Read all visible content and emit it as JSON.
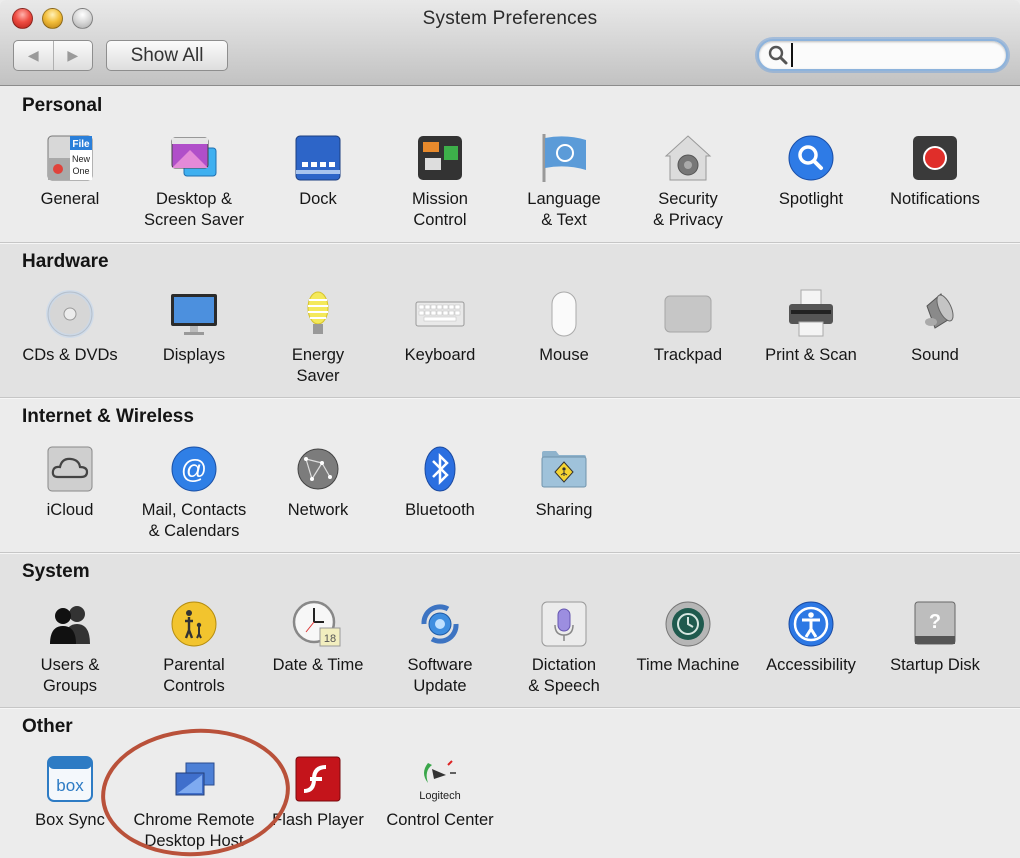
{
  "window": {
    "title": "System Preferences",
    "traffic_lights": [
      "close",
      "minimize",
      "zoom"
    ]
  },
  "toolbar": {
    "back_icon": "back-arrow-icon",
    "forward_icon": "forward-arrow-icon",
    "back_glyph": "◀",
    "forward_glyph": "▶",
    "show_all_label": "Show All",
    "search": {
      "value": "",
      "placeholder": "",
      "icon": "magnifier-icon"
    }
  },
  "sections": [
    {
      "title": "Personal",
      "items": [
        {
          "label": [
            "General"
          ],
          "icon": "general-icon"
        },
        {
          "label": [
            "Desktop &",
            "Screen Saver"
          ],
          "icon": "desktop-screensaver-icon"
        },
        {
          "label": [
            "Dock"
          ],
          "icon": "dock-icon"
        },
        {
          "label": [
            "Mission",
            "Control"
          ],
          "icon": "mission-control-icon"
        },
        {
          "label": [
            "Language",
            "& Text"
          ],
          "icon": "language-flag-icon"
        },
        {
          "label": [
            "Security",
            "& Privacy"
          ],
          "icon": "security-house-icon"
        },
        {
          "label": [
            "Spotlight"
          ],
          "icon": "spotlight-icon"
        },
        {
          "label": [
            "Notifications"
          ],
          "icon": "notifications-icon"
        }
      ]
    },
    {
      "title": "Hardware",
      "items": [
        {
          "label": [
            "CDs & DVDs"
          ],
          "icon": "cd-dvd-icon"
        },
        {
          "label": [
            "Displays"
          ],
          "icon": "display-icon"
        },
        {
          "label": [
            "Energy",
            "Saver"
          ],
          "icon": "lightbulb-icon"
        },
        {
          "label": [
            "Keyboard"
          ],
          "icon": "keyboard-icon"
        },
        {
          "label": [
            "Mouse"
          ],
          "icon": "mouse-icon"
        },
        {
          "label": [
            "Trackpad"
          ],
          "icon": "trackpad-icon"
        },
        {
          "label": [
            "Print & Scan"
          ],
          "icon": "printer-icon"
        },
        {
          "label": [
            "Sound"
          ],
          "icon": "speaker-icon"
        }
      ]
    },
    {
      "title": "Internet & Wireless",
      "items": [
        {
          "label": [
            "iCloud"
          ],
          "icon": "icloud-icon"
        },
        {
          "label": [
            "Mail, Contacts",
            "& Calendars"
          ],
          "icon": "at-sign-icon"
        },
        {
          "label": [
            "Network"
          ],
          "icon": "network-globe-icon"
        },
        {
          "label": [
            "Bluetooth"
          ],
          "icon": "bluetooth-icon"
        },
        {
          "label": [
            "Sharing"
          ],
          "icon": "sharing-folder-icon"
        }
      ]
    },
    {
      "title": "System",
      "items": [
        {
          "label": [
            "Users &",
            "Groups"
          ],
          "icon": "users-icon"
        },
        {
          "label": [
            "Parental",
            "Controls"
          ],
          "icon": "parental-controls-icon"
        },
        {
          "label": [
            "Date & Time"
          ],
          "icon": "clock-calendar-icon",
          "calendar_day": "18"
        },
        {
          "label": [
            "Software",
            "Update"
          ],
          "icon": "software-update-icon"
        },
        {
          "label": [
            "Dictation",
            "& Speech"
          ],
          "icon": "microphone-icon"
        },
        {
          "label": [
            "Time Machine"
          ],
          "icon": "time-machine-icon"
        },
        {
          "label": [
            "Accessibility"
          ],
          "icon": "accessibility-icon"
        },
        {
          "label": [
            "Startup Disk"
          ],
          "icon": "hard-disk-icon"
        }
      ]
    },
    {
      "title": "Other",
      "items": [
        {
          "label": [
            "Box Sync"
          ],
          "icon": "box-sync-icon",
          "logo_text": "box"
        },
        {
          "label": [
            "Chrome Remote",
            "Desktop Host"
          ],
          "icon": "chrome-remote-desktop-icon",
          "highlighted": true
        },
        {
          "label": [
            "Flash Player"
          ],
          "icon": "flash-player-icon"
        },
        {
          "label": [
            "Control Center"
          ],
          "icon": "logitech-icon",
          "logo_text": "Logitech"
        }
      ]
    }
  ],
  "annotation": {
    "type": "highlight-circle",
    "target": "Chrome Remote Desktop Host",
    "color": "#b9513a"
  }
}
